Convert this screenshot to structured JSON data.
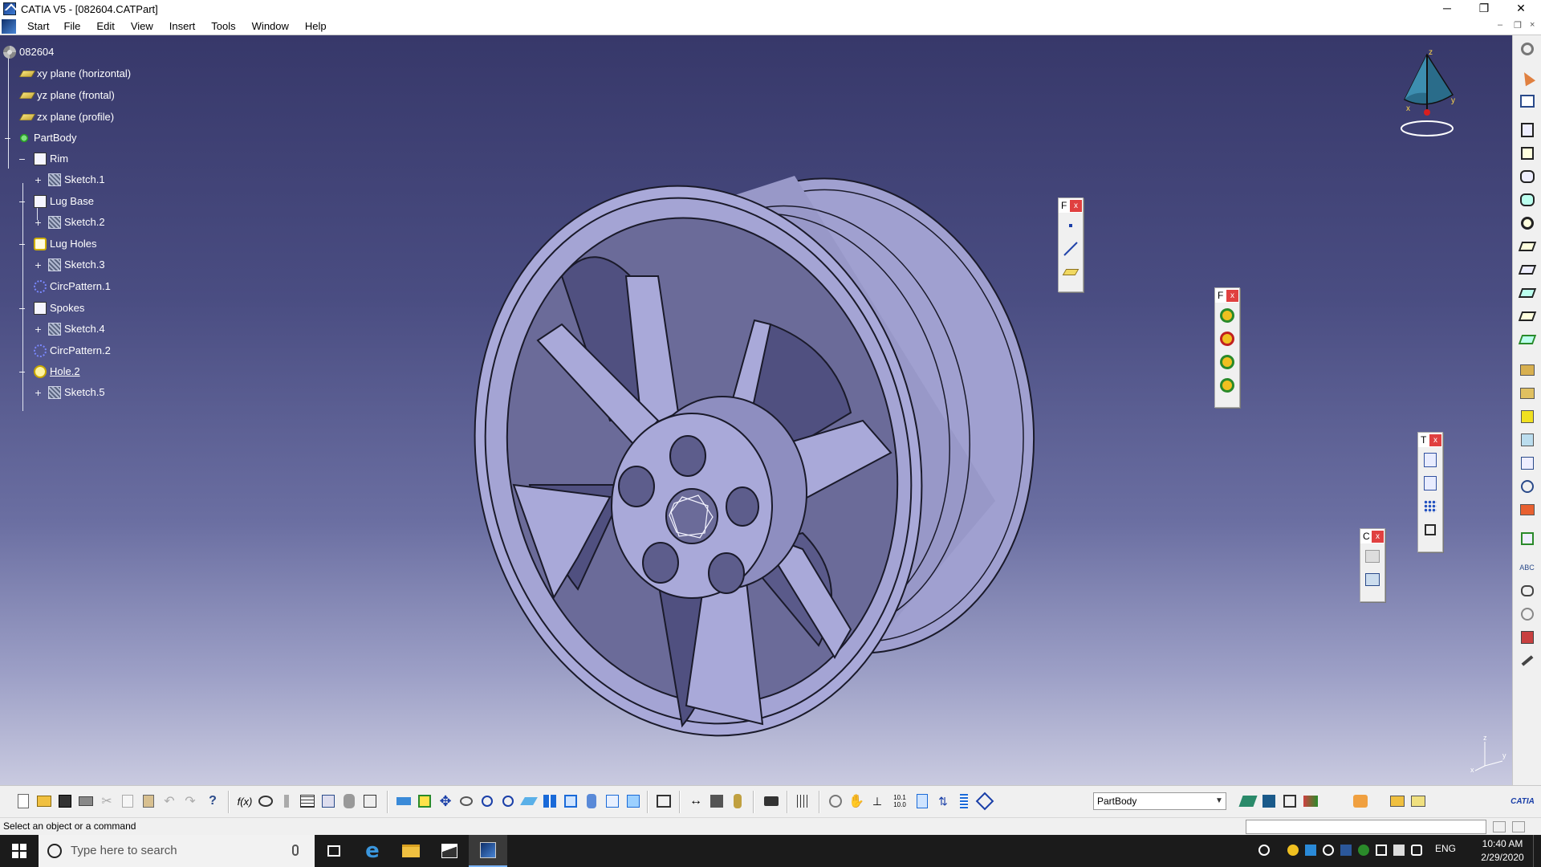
{
  "window": {
    "title": "CATIA V5 - [082604.CATPart]",
    "minimize_glyph": "─",
    "maximize_glyph": "❐",
    "close_glyph": "✕"
  },
  "menu": {
    "items": [
      "Start",
      "File",
      "Edit",
      "View",
      "Insert",
      "Tools",
      "Window",
      "Help"
    ],
    "mdi_minimize": "–",
    "mdi_restore": "❐",
    "mdi_close": "×"
  },
  "tree": {
    "root": "082604",
    "nodes": [
      {
        "label": "xy plane (horizontal)",
        "icon": "plane-icon"
      },
      {
        "label": "yz plane (frontal)",
        "icon": "plane-icon"
      },
      {
        "label": "zx plane (profile)",
        "icon": "plane-icon"
      },
      {
        "label": "PartBody",
        "icon": "partbody-icon"
      },
      {
        "label": "Rim",
        "icon": "shaft-icon"
      },
      {
        "label": "Sketch.1",
        "icon": "sketch-icon"
      },
      {
        "label": "Lug Base",
        "icon": "pad-icon"
      },
      {
        "label": "Sketch.2",
        "icon": "sketch-icon"
      },
      {
        "label": "Lug Holes",
        "icon": "pocket-icon"
      },
      {
        "label": "Sketch.3",
        "icon": "sketch-icon"
      },
      {
        "label": "CircPattern.1",
        "icon": "circpattern-icon"
      },
      {
        "label": "Spokes",
        "icon": "pad-icon"
      },
      {
        "label": "Sketch.4",
        "icon": "sketch-icon"
      },
      {
        "label": "CircPattern.2",
        "icon": "circpattern-icon"
      },
      {
        "label": "Hole.2",
        "icon": "hole-icon"
      },
      {
        "label": "Sketch.5",
        "icon": "sketch-icon"
      }
    ]
  },
  "floating_toolbars": {
    "reference": {
      "title": "F",
      "close": "x"
    },
    "features": {
      "title": "F",
      "close": "x"
    },
    "transform": {
      "title": "T",
      "close": "x"
    },
    "constraints": {
      "title": "C",
      "close": "x"
    }
  },
  "compass": {
    "x": "x",
    "y": "y",
    "z": "z"
  },
  "axis_indicator": {
    "x": "x",
    "y": "y",
    "z": "z"
  },
  "toolbar": {
    "current_body": "PartBody",
    "zoom_value": "10.1 10.0"
  },
  "status": {
    "message": "Select an object or a command"
  },
  "taskbar": {
    "search_placeholder": "Type here to search",
    "language": "ENG",
    "time": "10:40 AM",
    "date": "2/29/2020"
  },
  "colors": {
    "viewport_top": "#37386a",
    "viewport_bottom": "#c9cae0",
    "part_face": "#a7a7d6",
    "part_edge": "#1a1a2a"
  }
}
